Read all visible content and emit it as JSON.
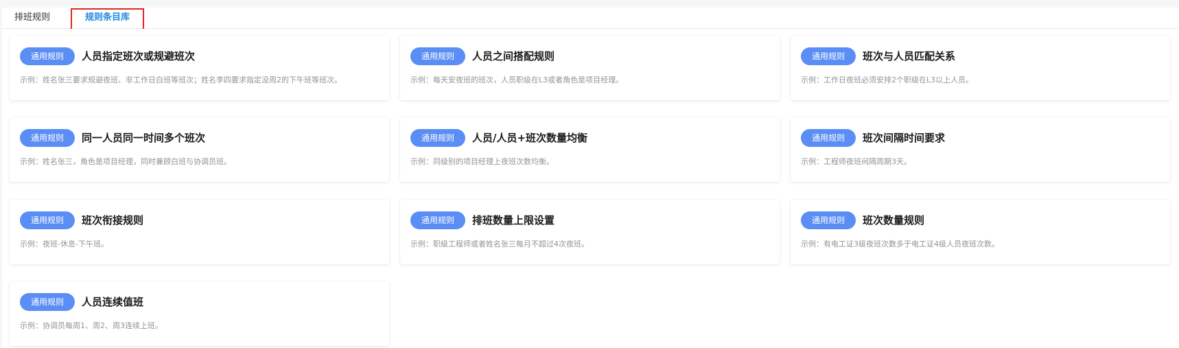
{
  "tabs": [
    {
      "label": "排班规则"
    },
    {
      "label": "规则条目库"
    }
  ],
  "rules": [
    {
      "badge": "通用规则",
      "title": "人员指定班次或规避班次",
      "desc": "示例：姓名张三要求规避夜班、非工作日白班等班次；姓名李四要求指定没周2的下午班等班次。"
    },
    {
      "badge": "通用规则",
      "title": "人员之间搭配规则",
      "desc": "示例：每天安夜班的班次，人员职级在L3或者角色是项目经理。"
    },
    {
      "badge": "通用规则",
      "title": "班次与人员匹配关系",
      "desc": "示例：工作日夜班必须安排2个职级在L3以上人员。"
    },
    {
      "badge": "通用规则",
      "title": "同一人员同一时间多个班次",
      "desc": "示例：姓名张三，角色是项目经理，同时兼顾白班与协调员班。"
    },
    {
      "badge": "通用规则",
      "title": "人员/人员+班次数量均衡",
      "desc": "示例：同级别的项目经理上夜班次数均衡。"
    },
    {
      "badge": "通用规则",
      "title": "班次间隔时间要求",
      "desc": "示例：工程师夜班间隔周期3天。"
    },
    {
      "badge": "通用规则",
      "title": "班次衔接规则",
      "desc": "示例：夜班-休息-下午班。"
    },
    {
      "badge": "通用规则",
      "title": "排班数量上限设置",
      "desc": "示例：职级工程师或者姓名张三每月不超过4次夜班。"
    },
    {
      "badge": "通用规则",
      "title": "班次数量规则",
      "desc": "示例：有电工证3级夜班次数多于电工证4级人员夜班次数。"
    },
    {
      "badge": "通用规则",
      "title": "人员连续值班",
      "desc": "示例：协调员每周1、周2、周3连续上班。"
    }
  ],
  "colors": {
    "badge": "#5b8ef5",
    "active_tab": "#1e88e5",
    "highlight_box": "#e5221b",
    "desc_text": "#909399"
  }
}
